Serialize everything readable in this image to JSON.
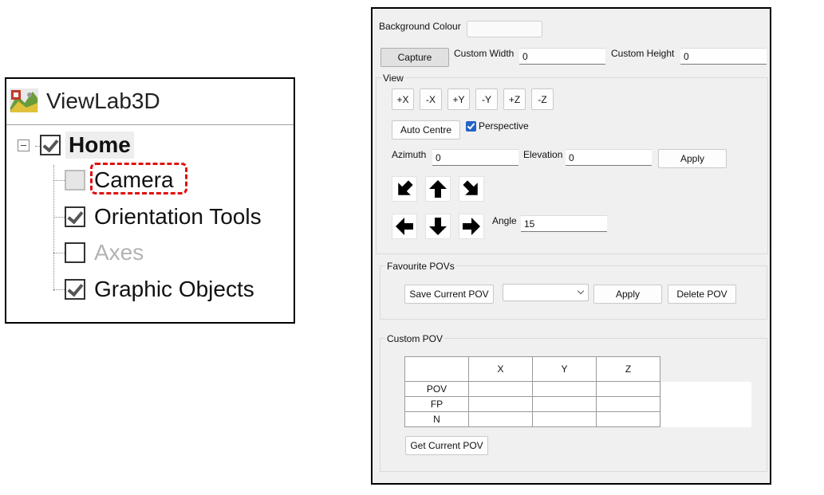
{
  "tree": {
    "app_title": "ViewLab3D",
    "items": [
      {
        "label": "Home",
        "checked": true
      },
      {
        "label": "Camera",
        "checked": false
      },
      {
        "label": "Orientation Tools",
        "checked": true
      },
      {
        "label": "Axes",
        "checked": false
      },
      {
        "label": "Graphic Objects",
        "checked": true
      }
    ]
  },
  "camera": {
    "background_colour_label": "Background Colour",
    "capture_button": "Capture",
    "custom_width_label": "Custom Width",
    "custom_width_value": "0",
    "custom_height_label": "Custom Height",
    "custom_height_value": "0",
    "view_label": "View",
    "axis_buttons": [
      "+X",
      "-X",
      "+Y",
      "-Y",
      "+Z",
      "-Z"
    ],
    "auto_centre_button": "Auto Centre",
    "perspective_label": "Perspective",
    "perspective_checked": true,
    "azimuth_label": "Azimuth",
    "azimuth_value": "0",
    "elevation_label": "Elevation",
    "elevation_value": "0",
    "apply_button": "Apply",
    "angle_label": "Angle",
    "angle_value": "15"
  },
  "favourites": {
    "title": "Favourite POVs",
    "save_button": "Save Current POV",
    "selected_pov": "",
    "apply_button": "Apply",
    "delete_button": "Delete POV"
  },
  "custom_pov": {
    "title": "Custom POV",
    "columns": [
      "X",
      "Y",
      "Z"
    ],
    "rows": [
      "POV",
      "FP",
      "N"
    ],
    "get_button": "Get Current POV"
  }
}
